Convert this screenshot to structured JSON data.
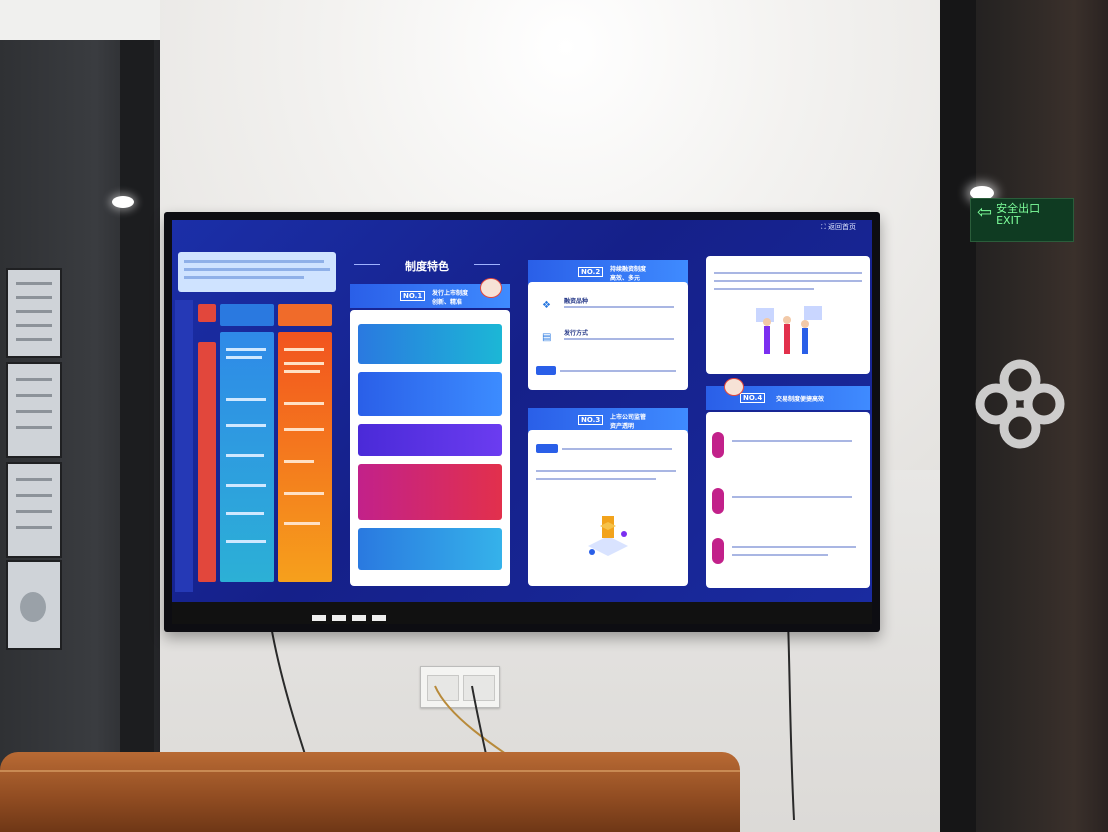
{
  "screen": {
    "top_right_text": "返回首页",
    "center_title": "制度特色",
    "panel_no1": {
      "badge": "NO.1",
      "title_line1": "发行上市制度",
      "title_line2": "创新、精准"
    },
    "panel_no2": {
      "badge": "NO.2",
      "title_line1": "持续融资制度",
      "title_line2": "高效、多元",
      "item1": "融资品种",
      "item2": "发行方式"
    },
    "panel_no3": {
      "badge": "NO.3",
      "title_line1": "上市公司监管",
      "title_line2": "资产透明"
    },
    "panel_no4": {
      "badge": "NO.4",
      "title": "交易制度便捷高效"
    }
  },
  "colors": {
    "screen_bg": "#1b2fa8",
    "accent_red": "#e2473c",
    "accent_orange": "#f28a1f",
    "accent_blue": "#2a79e0",
    "accent_magenta": "#d8277c",
    "accent_purple": "#7b2ff0",
    "accent_cyan": "#1cb7d6"
  },
  "room": {
    "exit_sign_line1": "安全出口",
    "exit_sign_line2": "EXIT"
  }
}
